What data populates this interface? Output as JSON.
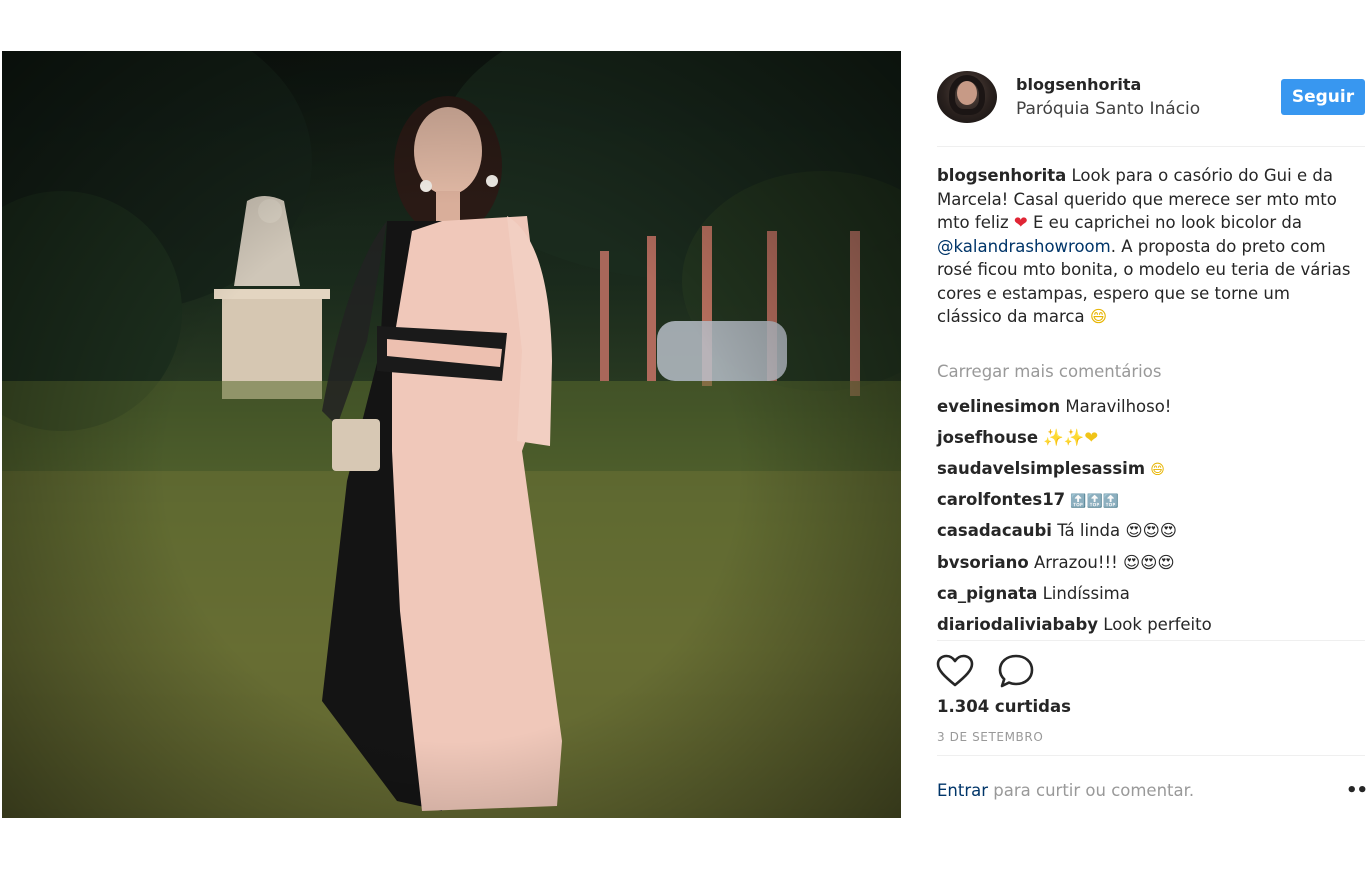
{
  "post": {
    "username": "blogsenhorita",
    "location": "Paróquia Santo Inácio",
    "follow_label": "Seguir",
    "caption": {
      "user": "blogsenhorita",
      "text_1": " Look para o casório do Gui e da Marcela! Casal querido que merece ser mto mto mto feliz ",
      "heart": "❤",
      "text_2": " E eu caprichei no look bicolor da ",
      "mention": "@kalandrashowroom",
      "text_3": ". A proposta do preto com rosé ficou mto bonita, o modelo eu teria de várias cores e estampas, espero que se torne um clássico da marca ",
      "smile": "😄"
    },
    "load_more": "Carregar mais comentários",
    "comments": [
      {
        "user": "evelinesimon",
        "text": "Maravilhoso!"
      },
      {
        "user": "josefhouse",
        "text": "✨✨❤"
      },
      {
        "user": "saudavelsimplesassim",
        "text": "😄"
      },
      {
        "user": "carolfontes17",
        "text": "🔝🔝🔝"
      },
      {
        "user": "casadacaubi",
        "text": "Tá linda 😍😍😍"
      },
      {
        "user": "bvsoriano",
        "text": "Arrazou!!! 😍😍😍"
      },
      {
        "user": "ca_pignata",
        "text": "Lindíssima"
      },
      {
        "user": "diariodaliviababy",
        "text": "Look perfeito"
      }
    ],
    "likes": "1.304 curtidas",
    "date": "3 DE SETEMBRO",
    "login_link": "Entrar",
    "login_text": " para curtir ou comentar.",
    "more_label": "•••"
  },
  "icons": {
    "like": "heart-outline-icon",
    "comment": "speech-bubble-icon",
    "more": "more-options-icon"
  },
  "colors": {
    "follow_button": "#3897f0",
    "link": "#003569",
    "muted": "#999999",
    "text": "#262626"
  }
}
